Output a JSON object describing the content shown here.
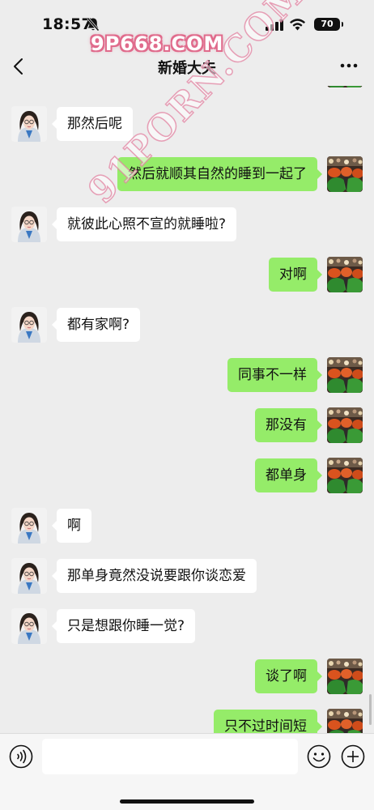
{
  "status_bar": {
    "time": "18:57",
    "battery": "70",
    "icons": [
      "bell-muted-icon",
      "signal-icon",
      "wifi-icon",
      "battery-icon"
    ]
  },
  "watermarks": {
    "top": "9P668.COM",
    "diagonal": "91PORN.COM"
  },
  "nav": {
    "title": "新婚大夫",
    "back_icon": "chevron-left-icon",
    "more_icon": "more-dots-icon"
  },
  "messages": [
    {
      "side": "in",
      "text": "那然后呢"
    },
    {
      "side": "out",
      "text": "然后就顺其自然的睡到一起了"
    },
    {
      "side": "in",
      "text": "就彼此心照不宣的就睡啦?"
    },
    {
      "side": "out",
      "text": "对啊"
    },
    {
      "side": "in",
      "text": "都有家啊?"
    },
    {
      "side": "out",
      "text": "同事不一样"
    },
    {
      "side": "out",
      "text": "那没有"
    },
    {
      "side": "out",
      "text": "都单身"
    },
    {
      "side": "in",
      "text": "啊"
    },
    {
      "side": "in",
      "text": "那单身竟然没说要跟你谈恋爱"
    },
    {
      "side": "in",
      "text": "只是想跟你睡一觉?"
    },
    {
      "side": "out",
      "text": "谈了啊"
    },
    {
      "side": "out",
      "text": "只不过时间短"
    }
  ],
  "input_bar": {
    "placeholder": "",
    "icons": [
      "voice-icon",
      "emoji-icon",
      "plus-icon"
    ]
  },
  "colors": {
    "background": "#ededed",
    "bubble_out": "#95ec69",
    "bubble_in": "#ffffff",
    "watermark": "#e06b8c"
  }
}
